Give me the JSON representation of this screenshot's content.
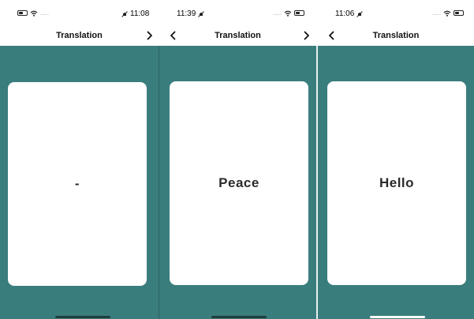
{
  "screens": [
    {
      "status": {
        "time": "11:08",
        "dots": "....."
      },
      "nav": {
        "title": "Translation",
        "has_back": false,
        "has_forward": true
      },
      "card": {
        "text": "-"
      }
    },
    {
      "status": {
        "time": "11:39",
        "dots": "....."
      },
      "nav": {
        "title": "Translation",
        "has_back": true,
        "has_forward": true
      },
      "card": {
        "text": "Peace"
      }
    },
    {
      "status": {
        "time": "11:06",
        "dots": "....."
      },
      "nav": {
        "title": "Translation",
        "has_back": true,
        "has_forward": false
      },
      "card": {
        "text": "Hello"
      }
    }
  ],
  "colors": {
    "background": "#3a7d7d",
    "card": "#ffffff",
    "text": "#2b2b2b"
  },
  "icons": {
    "back": "chevron-left-icon",
    "forward": "chevron-right-icon",
    "wifi": "wifi-icon",
    "battery": "battery-icon",
    "mute": "bell-slash-icon"
  }
}
